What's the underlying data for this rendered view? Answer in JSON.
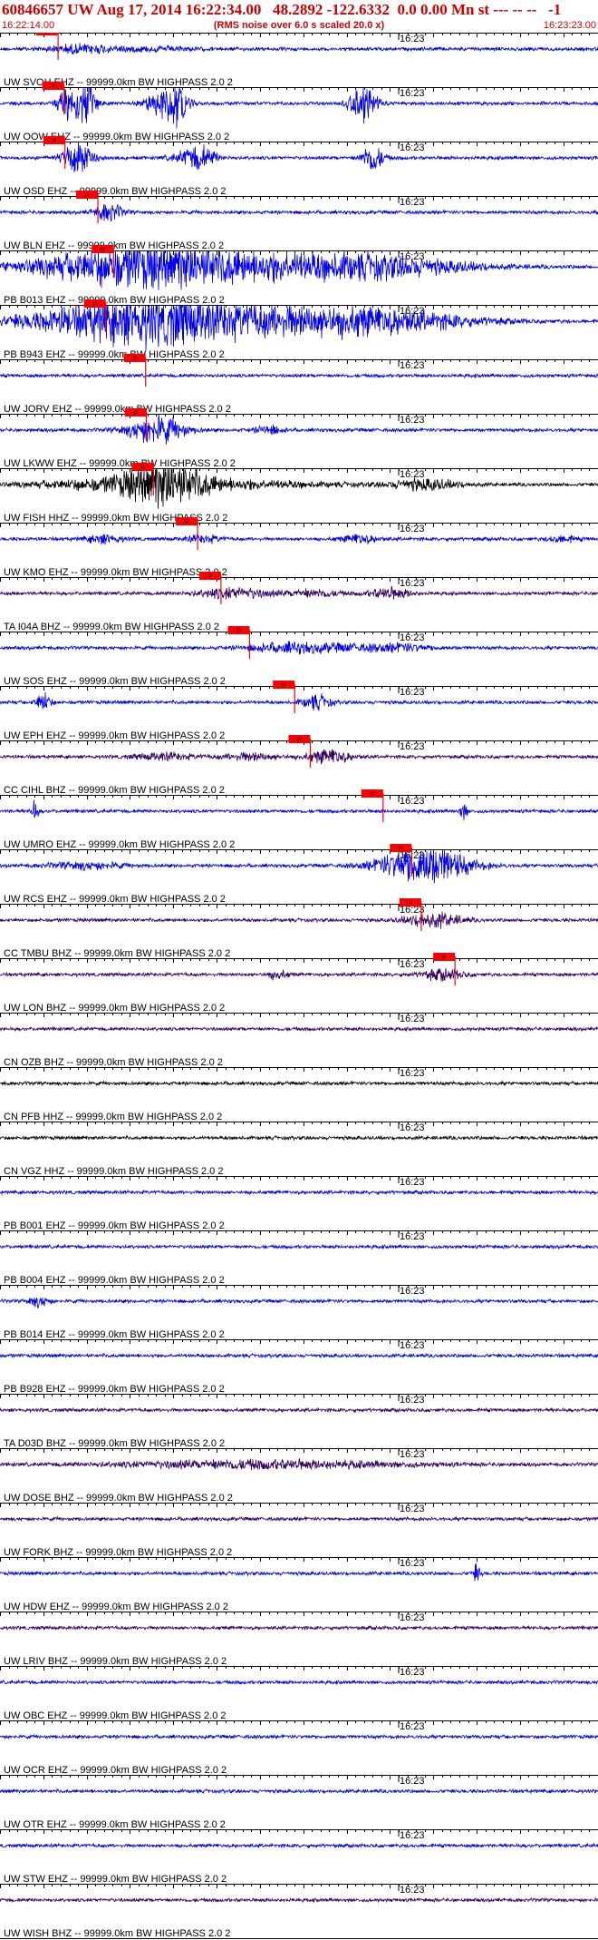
{
  "header": {
    "title": "60846657 UW Aug 17, 2014 16:22:34.00   48.2892 -122.6332  0.0 0.00 Mn st --- -- --   -1",
    "start_time": "16:22:14.00",
    "subtitle": "(RMS noise over 6.0 s scaled 20.0 x)",
    "end_time": "16:23:23.00"
  },
  "colors": {
    "trace_blue": "#0000ee",
    "trace_purple": "#330066",
    "trace_black": "#000000",
    "pick": "#ff0000",
    "header_text": "#cc0000"
  },
  "chart_data": {
    "type": "line",
    "x_axis": {
      "start": "16:22:14.00",
      "end": "16:23:23.00",
      "minute_mark": "16:23",
      "minute_mark_sec": 46
    },
    "pick_label": "P",
    "channels": [
      {
        "label": "UW SVOH EHZ -- 99999.0km BW  HIGHPASS  2.0  2",
        "color": "blue",
        "pick_sec": 6.7,
        "bursts": [
          [
            9.5,
            10,
            1.2
          ],
          [
            18,
            12,
            0.5
          ]
        ]
      },
      {
        "label": "UW OOW EHZ -- 99999.0km BW  HIGHPASS  2.0  2",
        "color": "blue",
        "pick_sec": 7.4,
        "bursts": [
          [
            8,
            3,
            6
          ],
          [
            10,
            3,
            5
          ],
          [
            19,
            5,
            4
          ],
          [
            20.5,
            3,
            4
          ],
          [
            42,
            4,
            5
          ]
        ]
      },
      {
        "label": "UW OSD EHZ -- 99999.0km BW  HIGHPASS  2.0  2",
        "color": "blue",
        "pick_sec": 7.5,
        "bursts": [
          [
            9,
            4,
            5
          ],
          [
            22,
            5,
            2
          ],
          [
            23.5,
            4,
            2
          ],
          [
            43,
            3,
            4
          ]
        ]
      },
      {
        "label": "UW BLN EHZ -- 99999.0km BW  HIGHPASS  2.0  2",
        "color": "blue",
        "pick_sec": 11.3,
        "bursts": [
          [
            12.5,
            4,
            2.5
          ]
        ]
      },
      {
        "label": "PB B013 EHZ -- 99999.0km BW  HIGHPASS  2.0  2",
        "color": "blue",
        "pick_sec": 13.1,
        "bursts": [
          [
            15,
            30,
            4
          ],
          [
            22,
            30,
            3
          ],
          [
            41,
            30,
            3.5
          ]
        ]
      },
      {
        "label": "PB B943 EHZ -- 99999.0km BW  HIGHPASS  2.0  2",
        "color": "blue",
        "pick_sec": 12.2,
        "bursts": [
          [
            15,
            30,
            4.5
          ],
          [
            22,
            30,
            3
          ],
          [
            41,
            30,
            4
          ]
        ]
      },
      {
        "label": "UW JORV EHZ -- 99999.0km BW  HIGHPASS  2.0  2",
        "color": "blue",
        "pick_sec": 16.8,
        "bursts": []
      },
      {
        "label": "UW LKWW EHZ -- 99999.0km BW  HIGHPASS  2.0  2",
        "color": "blue",
        "pick_sec": 16.9,
        "bursts": [
          [
            18,
            8,
            4
          ],
          [
            31,
            4,
            1.2
          ]
        ]
      },
      {
        "label": "UW FISH HHZ -- 99999.0km BW  HIGHPASS  2.0  2",
        "color": "black",
        "pick_sec": 17.7,
        "bursts": [
          [
            19,
            12,
            6
          ],
          [
            11,
            20,
            1.2
          ],
          [
            28,
            25,
            1
          ],
          [
            49,
            10,
            1.5
          ]
        ]
      },
      {
        "label": "UW KMO EHZ -- 99999.0km BW  HIGHPASS  2.0  2",
        "color": "blue",
        "pick_sec": 22.8,
        "bursts": [
          [
            12,
            5,
            1.2
          ],
          [
            23.5,
            5,
            1
          ],
          [
            41.5,
            5,
            1.2
          ],
          [
            65,
            4,
            1
          ]
        ]
      },
      {
        "label": "TA I04A BHZ -- 99999.0km BW  HIGHPASS  2.0  2",
        "color": "purple",
        "pick_sec": 25.5,
        "bursts": [
          [
            27,
            10,
            1.5
          ],
          [
            36,
            8,
            1
          ],
          [
            45,
            6,
            1.5
          ]
        ]
      },
      {
        "label": "UW SOS EHZ -- 99999.0km BW  HIGHPASS  2.0  2",
        "color": "blue",
        "pick_sec": 28.8,
        "bursts": [
          [
            32,
            10,
            1
          ],
          [
            38,
            12,
            1
          ],
          [
            46,
            10,
            1
          ]
        ]
      },
      {
        "label": "UW EPH EHZ -- 99999.0km BW  HIGHPASS  2.0  2",
        "color": "blue",
        "pick_sec": 34,
        "bursts": [
          [
            5,
            2,
            3
          ],
          [
            36.5,
            4,
            2
          ]
        ]
      },
      {
        "label": "CC CIHL BHZ -- 99999.0km BW  HIGHPASS  2.0  2",
        "color": "purple",
        "pick_sec": 35.8,
        "bursts": [
          [
            19,
            8,
            1
          ],
          [
            38,
            6,
            2
          ],
          [
            29,
            8,
            1
          ]
        ]
      },
      {
        "label": "UW UMRO EHZ -- 99999.0km BW  HIGHPASS  2.0  2",
        "color": "blue",
        "pick_sec": 44.2,
        "bursts": [
          [
            4,
            1,
            3
          ],
          [
            53.5,
            1,
            2.5
          ]
        ]
      },
      {
        "label": "UW RCS EHZ -- 99999.0km BW  HIGHPASS  2.0  2",
        "color": "blue",
        "pick_sec": 47.5,
        "bursts": [
          [
            49,
            12,
            6
          ],
          [
            10,
            10,
            1
          ]
        ]
      },
      {
        "label": "CC TMBU BHZ -- 99999.0km BW  HIGHPASS  2.0  2",
        "color": "purple",
        "pick_sec": 48.6,
        "bursts": [
          [
            50,
            8,
            2
          ]
        ]
      },
      {
        "label": "UW LON BHZ -- 99999.0km BW  HIGHPASS  2.0  2",
        "color": "purple",
        "pick_sec": 52.5,
        "bursts": [
          [
            51,
            6,
            1.5
          ],
          [
            32,
            3,
            1.2
          ]
        ]
      },
      {
        "label": "CN OZB BHZ -- 99999.0km BW  HIGHPASS  2.0  2",
        "color": "purple",
        "pick_sec": null,
        "bursts": []
      },
      {
        "label": "CN PFB HHZ -- 99999.0km BW  HIGHPASS  2.0  2",
        "color": "black",
        "pick_sec": null,
        "bursts": []
      },
      {
        "label": "CN VGZ HHZ -- 99999.0km BW  HIGHPASS  2.0  2",
        "color": "black",
        "pick_sec": null,
        "bursts": []
      },
      {
        "label": "PB B001 EHZ -- 99999.0km BW  HIGHPASS  2.0  2",
        "color": "blue",
        "pick_sec": null,
        "bursts": []
      },
      {
        "label": "PB B004 EHZ -- 99999.0km BW  HIGHPASS  2.0  2",
        "color": "blue",
        "pick_sec": null,
        "bursts": []
      },
      {
        "label": "PB B014 EHZ -- 99999.0km BW  HIGHPASS  2.0  2",
        "color": "blue",
        "pick_sec": null,
        "bursts": [
          [
            4.5,
            3,
            1.5
          ]
        ]
      },
      {
        "label": "PB B928 EHZ -- 99999.0km BW  HIGHPASS  2.0  2",
        "color": "blue",
        "pick_sec": null,
        "bursts": []
      },
      {
        "label": "TA D03D BHZ -- 99999.0km BW  HIGHPASS  2.0  2",
        "color": "purple",
        "pick_sec": null,
        "bursts": []
      },
      {
        "label": "UW DOSE BHZ -- 99999.0km BW  HIGHPASS  2.0  2",
        "color": "purple",
        "pick_sec": null,
        "bursts": [
          [
            30,
            40,
            1.2
          ]
        ]
      },
      {
        "label": "UW FORK BHZ -- 99999.0km BW  HIGHPASS  2.0  2",
        "color": "purple",
        "pick_sec": null,
        "bursts": []
      },
      {
        "label": "UW HDW EHZ -- 99999.0km BW  HIGHPASS  2.0  2",
        "color": "blue",
        "pick_sec": null,
        "bursts": [
          [
            55,
            1,
            2.5
          ]
        ]
      },
      {
        "label": "UW LRIV BHZ -- 99999.0km BW  HIGHPASS  2.0  2",
        "color": "purple",
        "pick_sec": null,
        "bursts": []
      },
      {
        "label": "UW OBC EHZ -- 99999.0km BW  HIGHPASS  2.0  2",
        "color": "blue",
        "pick_sec": null,
        "bursts": []
      },
      {
        "label": "UW OCR EHZ -- 99999.0km BW  HIGHPASS  2.0  2",
        "color": "blue",
        "pick_sec": null,
        "bursts": []
      },
      {
        "label": "UW OTR EHZ -- 99999.0km BW  HIGHPASS  2.0  2",
        "color": "blue",
        "pick_sec": null,
        "bursts": []
      },
      {
        "label": "UW STW EHZ -- 99999.0km BW  HIGHPASS  2.0  2",
        "color": "blue",
        "pick_sec": null,
        "bursts": []
      },
      {
        "label": "UW WISH BHZ -- 99999.0km BW  HIGHPASS  2.0  2",
        "color": "purple",
        "pick_sec": null,
        "bursts": []
      }
    ]
  }
}
